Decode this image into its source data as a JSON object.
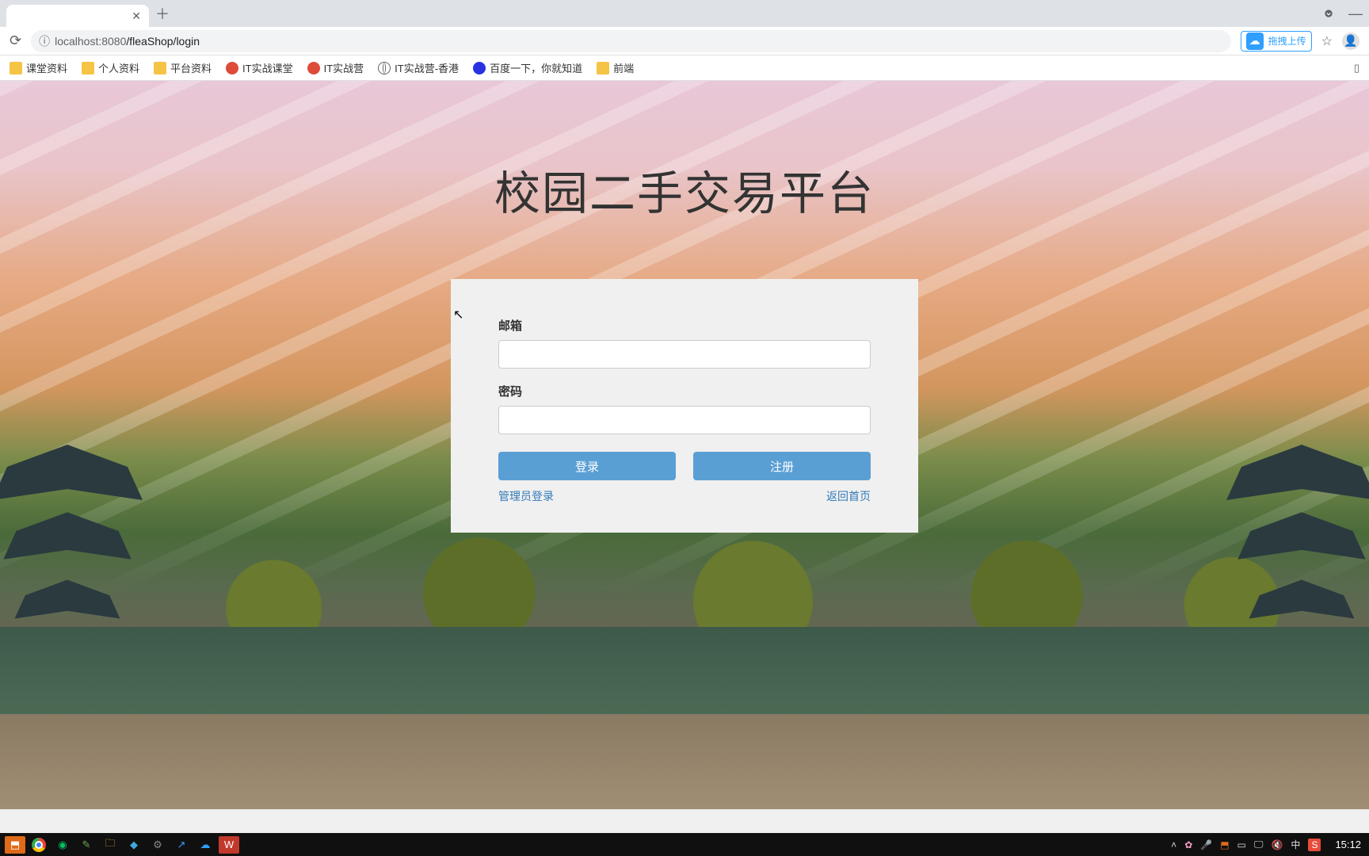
{
  "browser": {
    "url_host": "localhost:8080",
    "url_path": "/fleaShop/login",
    "extension_label": "拖拽上传"
  },
  "bookmarks": [
    {
      "label": "课堂资料",
      "icon": "folder"
    },
    {
      "label": "个人资料",
      "icon": "folder"
    },
    {
      "label": "平台资料",
      "icon": "folder"
    },
    {
      "label": "IT实战课堂",
      "icon": "red"
    },
    {
      "label": "IT实战营",
      "icon": "red"
    },
    {
      "label": "IT实战营-香港",
      "icon": "globe"
    },
    {
      "label": "百度一下，你就知道",
      "icon": "baidu"
    },
    {
      "label": "前端",
      "icon": "folder"
    }
  ],
  "page": {
    "title": "校园二手交易平台",
    "login": {
      "email_label": "邮箱",
      "password_label": "密码",
      "login_button": "登录",
      "register_button": "注册",
      "admin_login_link": "管理员登录",
      "back_home_link": "返回首页"
    }
  },
  "taskbar": {
    "ime": "中",
    "clock": "15:12"
  }
}
